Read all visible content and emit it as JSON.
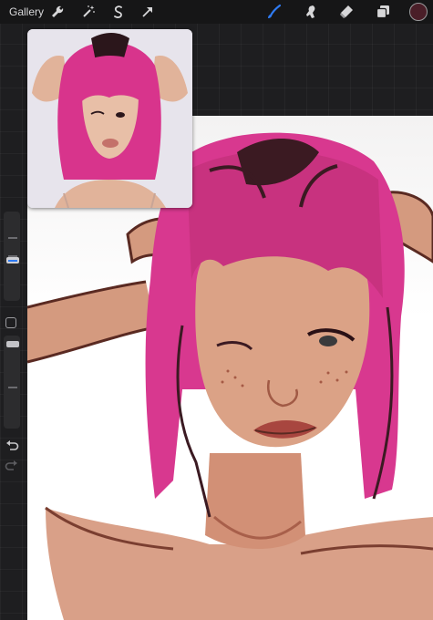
{
  "topbar": {
    "gallery_label": "Gallery",
    "left_tools": [
      "wrench-icon",
      "magic-wand-icon",
      "selection-icon",
      "transform-arrow-icon"
    ],
    "right_tools": [
      "brush-icon",
      "smudge-icon",
      "eraser-icon",
      "layers-icon"
    ],
    "active_tool": "brush-icon",
    "accent_color": "#2f7bf2",
    "current_color": "#4a1e28"
  },
  "sidebar": {
    "size_slider_fraction": 0.55,
    "opacity_slider_fraction": 0.0,
    "icons": [
      "undo-icon",
      "redo-icon"
    ]
  },
  "colors": {
    "hair": "#d8388f",
    "hair_dark": "#3b1a22",
    "skin": "#d49a7f",
    "line": "#5a2a22"
  }
}
